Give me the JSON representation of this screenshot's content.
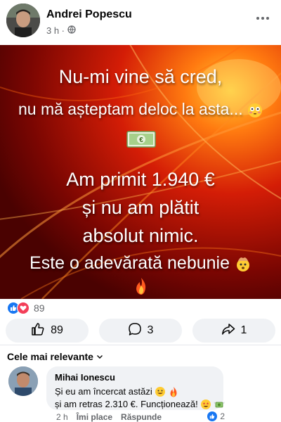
{
  "post": {
    "author": "Andrei Popescu",
    "time": "3 h ·",
    "privacy_icon": "globe-icon"
  },
  "image_text": {
    "line1": "Nu-mi vine să cred,",
    "line2": "nu mă așteptam deloc la asta...",
    "line3": "Am primit 1.940 €",
    "line4": "și nu am plătit",
    "line5": "absolut nimic.",
    "line6": "Este o adevărată nebunie"
  },
  "reactions": {
    "count": "89",
    "icons": [
      "like-icon",
      "love-icon"
    ]
  },
  "actions": {
    "like_count": "89",
    "comment_count": "3",
    "share_count": "1"
  },
  "comments": {
    "filter_label": "Cele mai relevante",
    "items": [
      {
        "author": "Mihai Ionescu",
        "line1": "Și eu am încercat astăzi",
        "line2": "și am retras 2.310 €. Funcționează!",
        "time": "2 h",
        "like_label": "Îmi place",
        "reply_label": "Răspunde",
        "reaction_count": "2"
      }
    ]
  },
  "colors": {
    "accent": "#1877f2",
    "love": "#f33e58",
    "pill_bg": "#f0f2f5",
    "secondary_text": "#65676b",
    "image_bg": "#8b0a02"
  }
}
